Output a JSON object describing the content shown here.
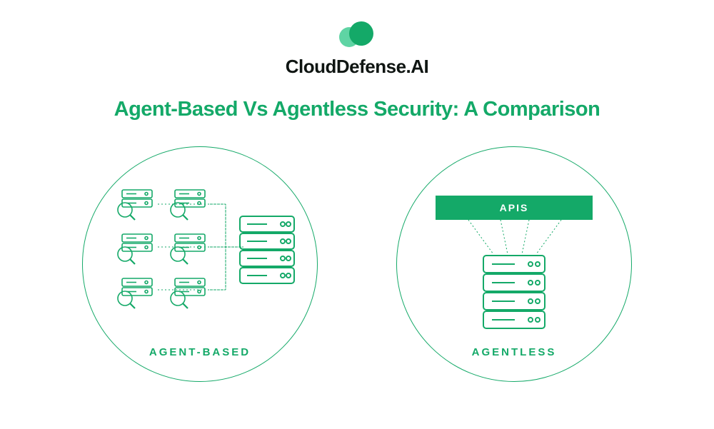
{
  "brand": "CloudDefense.AI",
  "title": "Agent-Based Vs Agentless Security: A Comparison",
  "left": {
    "label": "AGENT-BASED"
  },
  "right": {
    "label": "AGENTLESS",
    "apis": "APIS"
  },
  "colors": {
    "primary": "#14a968",
    "light": "#5fd4a4"
  }
}
